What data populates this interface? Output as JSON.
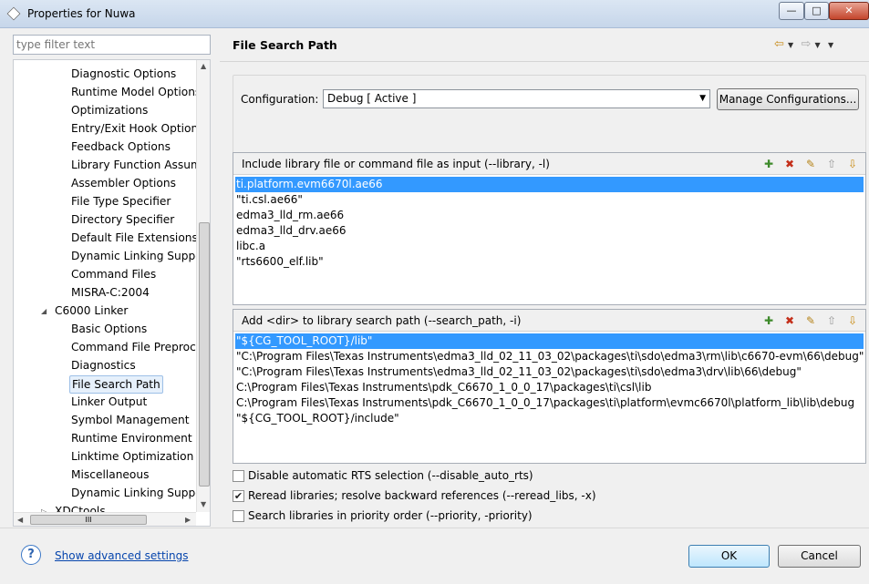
{
  "window": {
    "title": "Properties for Nuwa",
    "min_label": "—",
    "max_label": "□",
    "close_label": "✕"
  },
  "left": {
    "filter_placeholder": "type filter text",
    "tree": [
      "Diagnostic Options",
      "Runtime Model Options",
      "Optimizations",
      "Entry/Exit Hook Options",
      "Feedback Options",
      "Library Function Assump",
      "Assembler Options",
      "File Type Specifier",
      "Directory Specifier",
      "Default File Extensions",
      "Dynamic Linking Suppo",
      "Command Files",
      "MISRA-C:2004",
      "C6000 Linker",
      "Basic Options",
      "Command File Preproce",
      "Diagnostics",
      "File Search Path",
      "Linker Output",
      "Symbol Management",
      "Runtime Environment",
      "Linktime Optimization",
      "Miscellaneous",
      "Dynamic Linking Suppo",
      "XDCtools"
    ],
    "selected": "File Search Path"
  },
  "page": {
    "title": "File Search Path",
    "configuration_label": "Configuration:",
    "configuration_value": "Debug  [ Active ]",
    "manage_button": "Manage Configurations..."
  },
  "libraries": {
    "title": "Include library file or command file as input (--library, -l)",
    "items": [
      "ti.platform.evm6670l.ae66",
      "\"ti.csl.ae66\"",
      "edma3_lld_rm.ae66",
      "edma3_lld_drv.ae66",
      "libc.a",
      "\"rts6600_elf.lib\""
    ]
  },
  "search_paths": {
    "title": "Add <dir> to library search path (--search_path, -i)",
    "items": [
      "\"${CG_TOOL_ROOT}/lib\"",
      "\"C:\\Program Files\\Texas Instruments\\edma3_lld_02_11_03_02\\packages\\ti\\sdo\\edma3\\rm\\lib\\c6670-evm\\66\\debug\"",
      "\"C:\\Program Files\\Texas Instruments\\edma3_lld_02_11_03_02\\packages\\ti\\sdo\\edma3\\drv\\lib\\66\\debug\"",
      "C:\\Program Files\\Texas Instruments\\pdk_C6670_1_0_0_17\\packages\\ti\\csl\\lib",
      "C:\\Program Files\\Texas Instruments\\pdk_C6670_1_0_0_17\\packages\\ti\\platform\\evmc6670l\\platform_lib\\lib\\debug",
      "\"${CG_TOOL_ROOT}/include\""
    ]
  },
  "options": [
    {
      "label": "Disable automatic RTS selection (--disable_auto_rts)",
      "checked": false
    },
    {
      "label": "Reread libraries; resolve backward references (--reread_libs, -x)",
      "checked": true
    },
    {
      "label": "Search libraries in priority order (--priority, -priority)",
      "checked": false
    }
  ],
  "footer": {
    "advanced_link": "Show advanced settings",
    "ok": "OK",
    "cancel": "Cancel"
  },
  "icons": {
    "nav": [
      "back-arrow-icon",
      "forward-arrow-icon",
      "view-menu-icon"
    ],
    "list_toolbar": [
      "add-icon",
      "delete-icon",
      "edit-icon",
      "move-up-icon",
      "move-down-icon"
    ]
  }
}
